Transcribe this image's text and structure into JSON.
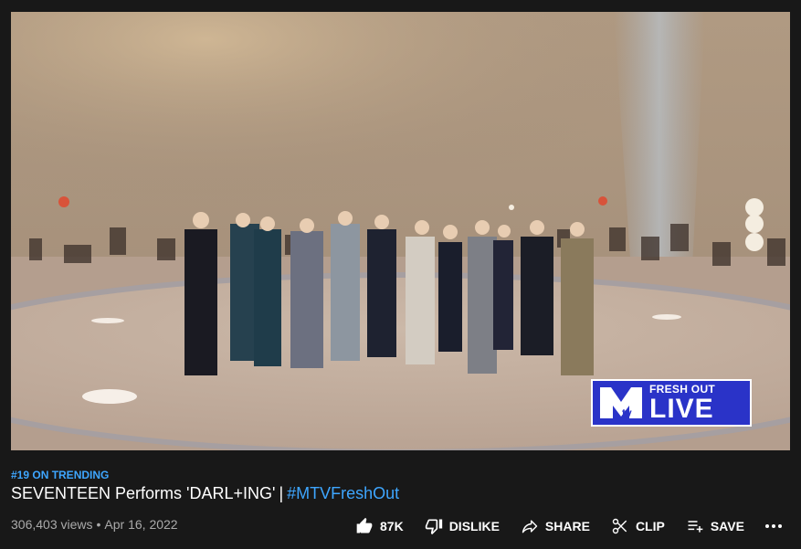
{
  "video": {
    "badge_small": "FRESH OUT",
    "badge_big": "LIVE"
  },
  "info": {
    "trending": "#19 ON TRENDING",
    "title_main": "SEVENTEEN Performs 'DARL+ING'",
    "title_separator": "|",
    "title_hashtag": "#MTVFreshOut",
    "views": "306,403 views",
    "date": "Apr 16, 2022"
  },
  "actions": {
    "like": "87K",
    "dislike": "DISLIKE",
    "share": "SHARE",
    "clip": "CLIP",
    "save": "SAVE"
  },
  "icons": [
    "thumb-up-icon",
    "thumb-down-icon",
    "share-icon",
    "scissors-icon",
    "playlist-add-icon",
    "more-icon"
  ],
  "colors": {
    "background": "#181818",
    "link": "#3ea6ff",
    "badge": "#2a33c8"
  }
}
